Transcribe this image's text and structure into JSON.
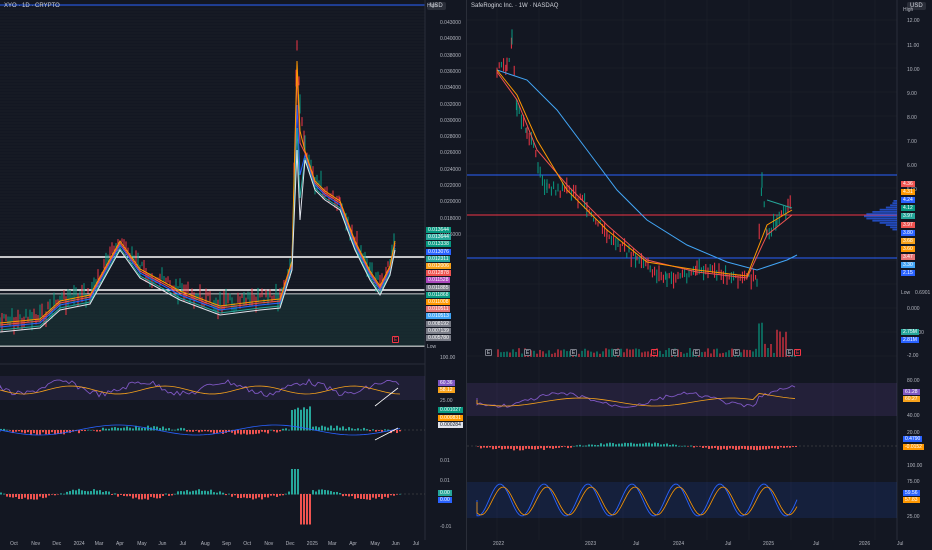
{
  "left": {
    "title": "XYO · 1D · CRYPTO",
    "currency_badge": "USD",
    "high_label": "High",
    "low_label": "Low",
    "price_axis": [
      "0.043000",
      "0.040000",
      "0.038000",
      "0.036000",
      "0.034000",
      "0.032000",
      "0.030000",
      "0.028000",
      "0.026000",
      "0.024000",
      "0.022000",
      "0.020000",
      "0.018000",
      "0.016000"
    ],
    "price_tags": [
      {
        "text": "0.013644",
        "color": "#089981"
      },
      {
        "text": "0.013644",
        "color": "#26a69a"
      },
      {
        "text": "0.013338",
        "color": "#089981"
      },
      {
        "text": "0.013076",
        "color": "#2962ff"
      },
      {
        "text": "0.012311",
        "color": "#26a69a"
      },
      {
        "text": "0.012006",
        "color": "#f7a21b"
      },
      {
        "text": "0.012878",
        "color": "#ef5350"
      },
      {
        "text": "0.011528",
        "color": "#ab47bc"
      },
      {
        "text": "0.011885",
        "color": "#787b86"
      },
      {
        "text": "0.011868",
        "color": "#089981"
      },
      {
        "text": "0.011008",
        "color": "#ff9800"
      },
      {
        "text": "0.010511",
        "color": "#e57373"
      },
      {
        "text": "0.010513",
        "color": "#42a5f5"
      },
      {
        "text": "0.008192",
        "color": "#787b86"
      },
      {
        "text": "0.007139",
        "color": "#787b86"
      },
      {
        "text": "0.005780",
        "color": "#787b86"
      }
    ],
    "rsi_axis": [
      "100.00",
      "25.00"
    ],
    "rsi_tags": [
      {
        "text": "60.36",
        "color": "#7e57c2"
      },
      {
        "text": "58.12",
        "color": "#f7a21b"
      }
    ],
    "macd_tags": [
      {
        "text": "0.001027",
        "color": "#089981"
      },
      {
        "text": "0.000831",
        "color": "#ff9800"
      },
      {
        "text": "0.000284",
        "color": "#e0e3eb"
      }
    ],
    "osc_axis": [
      "0.01",
      "0.01",
      "-0.01"
    ],
    "osc_tags": [
      {
        "text": "0.00",
        "color": "#26a69a"
      },
      {
        "text": "0.00",
        "color": "#2962ff"
      }
    ],
    "time_axis": [
      "Oct",
      "Nov",
      "Dec",
      "2024",
      "Mar",
      "Apr",
      "May",
      "Jun",
      "Jul",
      "Aug",
      "Sep",
      "Oct",
      "Nov",
      "Dec",
      "2025",
      "Mar",
      "Apr",
      "May",
      "Jun",
      "Jul"
    ]
  },
  "right": {
    "title": "SafeRoginc Inc. · 1W · NASDAQ",
    "currency_badge": "USD",
    "high_label": "High",
    "low_label": "Low",
    "price_axis": [
      "12.00",
      "11.00",
      "10.00",
      "9.00",
      "8.00",
      "7.00",
      "6.00",
      "5.00",
      "0.000",
      "-1.0000",
      "-2.00"
    ],
    "price_tags": [
      {
        "text": "4.36",
        "color": "#ef5350"
      },
      {
        "text": "4.31",
        "color": "#ff9800"
      },
      {
        "text": "4.24",
        "color": "#2962ff"
      },
      {
        "text": "4.12",
        "color": "#089981"
      },
      {
        "text": "3.97",
        "color": "#26a69a"
      },
      {
        "text": "3.97",
        "color": "#ef5350"
      },
      {
        "text": "3.80",
        "color": "#2962ff"
      },
      {
        "text": "3.68",
        "color": "#f7a21b"
      },
      {
        "text": "3.60",
        "color": "#ff9800"
      },
      {
        "text": "3.47",
        "color": "#e57373"
      },
      {
        "text": "3.30",
        "color": "#42a5f5"
      },
      {
        "text": "2.15",
        "color": "#2962ff"
      },
      {
        "text": "2.75M",
        "color": "#26a69a"
      },
      {
        "text": "2.81M",
        "color": "#2962ff"
      }
    ],
    "low_value": "0.6901",
    "rsi_axis": [
      "80.00",
      "40.00",
      "20.00"
    ],
    "rsi_tags": [
      {
        "text": "61.28",
        "color": "#7e57c2"
      },
      {
        "text": "60.27",
        "color": "#f7a21b"
      }
    ],
    "macd_tags": [
      {
        "text": "0.4790",
        "color": "#2962ff"
      },
      {
        "text": "-0.0152",
        "color": "#ff9800"
      }
    ],
    "macd_axis": [
      "100.00"
    ],
    "stoch_axis": [
      "75.00",
      "50.00",
      "25.00"
    ],
    "stoch_tags": [
      {
        "text": "59.56",
        "color": "#2962ff"
      },
      {
        "text": "57.83",
        "color": "#ff9800"
      }
    ],
    "time_axis": [
      "2022",
      "2023",
      "Jul",
      "2024",
      "Jul",
      "2025",
      "Jul",
      "2026",
      "Jul"
    ]
  }
}
